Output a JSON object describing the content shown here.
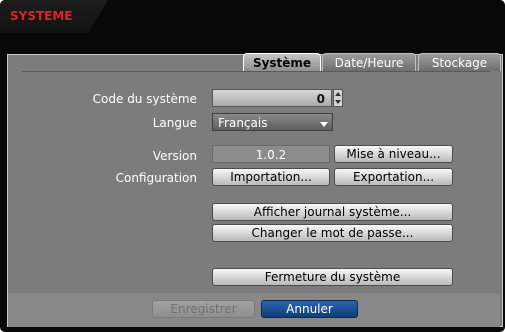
{
  "window": {
    "title": "SYSTEME"
  },
  "tabs": [
    {
      "label": "Système",
      "active": true
    },
    {
      "label": "Date/Heure",
      "active": false
    },
    {
      "label": "Stockage",
      "active": false
    }
  ],
  "form": {
    "system_code": {
      "label": "Code du système",
      "value": "0"
    },
    "language": {
      "label": "Langue",
      "value": "Français"
    },
    "version": {
      "label": "Version",
      "value": "1.0.2",
      "upgrade_button": "Mise à niveau..."
    },
    "configuration": {
      "label": "Configuration",
      "import_button": "Importation...",
      "export_button": "Exportation..."
    },
    "show_log_button": "Afficher journal système...",
    "change_password_button": "Changer le mot de passe...",
    "shutdown_button": "Fermeture du système"
  },
  "footer": {
    "save_button": "Enregistrer",
    "cancel_button": "Annuler"
  },
  "colors": {
    "title": "#e0202a",
    "accent_button": "#1a4a8c",
    "panel": "#7c7c7c"
  }
}
